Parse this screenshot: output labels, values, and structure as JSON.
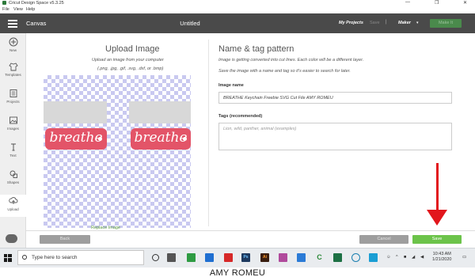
{
  "window": {
    "app_title": "Cricut Design Space  v5.3.25",
    "menu": [
      "File",
      "View",
      "Help"
    ],
    "controls": [
      "—",
      "❐",
      "✕"
    ]
  },
  "header": {
    "canvas_label": "Canvas",
    "document_title": "Untitled",
    "my_projects": "My Projects",
    "save": "Save",
    "separator": "|",
    "machine": "Maker",
    "make_it": "Make It"
  },
  "sidebar": {
    "items": [
      {
        "label": "New",
        "icon": "plus-icon"
      },
      {
        "label": "Templates",
        "icon": "shirt-icon"
      },
      {
        "label": "Projects",
        "icon": "projects-icon"
      },
      {
        "label": "Images",
        "icon": "image-icon"
      },
      {
        "label": "Text",
        "icon": "text-icon"
      },
      {
        "label": "Shapes",
        "icon": "shapes-icon"
      },
      {
        "label": "Upload",
        "icon": "upload-icon"
      }
    ],
    "active": "Upload"
  },
  "upload_panel": {
    "title": "Upload Image",
    "subtitle": "Upload an image from your computer",
    "file_types": "(.png, .jpg, .gif, .svg, .dxf, or .bmp)",
    "preview_word": "breathe",
    "replace_link": "Replace Image"
  },
  "name_panel": {
    "title": "Name & tag pattern",
    "info_line1": "Image is getting converted into cut lines. Each color will be a different layer.",
    "info_line2": "Save the image with a name and tag so it's easier to search for later.",
    "image_name_label": "Image name",
    "image_name_value": "BREATHE Keychain Freebie SVG Cut File AMY ROMEU",
    "tags_label": "Tags (recommended)",
    "tags_placeholder": "Lion, wild, panther, animal (examples)"
  },
  "footer": {
    "back": "Back",
    "cancel": "Cancel",
    "save": "Save"
  },
  "taskbar": {
    "search_placeholder": "Type here to search",
    "clock_time": "10:43 AM",
    "clock_date": "1/21/2020"
  },
  "watermark": "AMY ROMEU",
  "colors": {
    "header_bg": "#4a4a4a",
    "brand_green": "#6cc34a",
    "tag_pink": "#e35468",
    "annotation_red": "#e2161c"
  }
}
